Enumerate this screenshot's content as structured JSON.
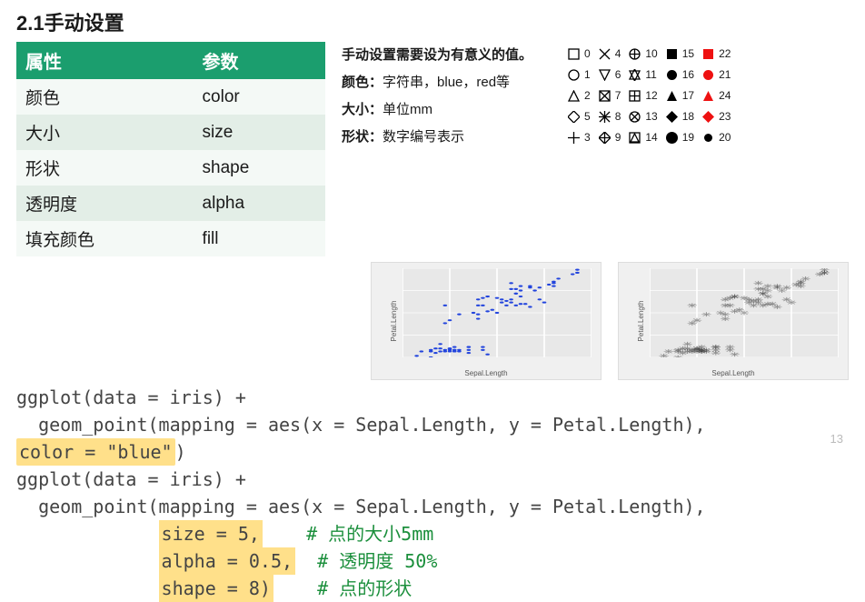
{
  "section_title": "2.1手动设置",
  "table": {
    "header_attr": "属性",
    "header_param": "参数",
    "rows": [
      {
        "attr": "颜色",
        "param": "color"
      },
      {
        "attr": "大小",
        "param": "size"
      },
      {
        "attr": "形状",
        "param": "shape"
      },
      {
        "attr": "透明度",
        "param": "alpha"
      },
      {
        "attr": "填充颜色",
        "param": "fill"
      }
    ]
  },
  "description": {
    "line1": "手动设置需要设为有意义的值。",
    "line2a": "颜色：",
    "line2b": "字符串，blue，red等",
    "line3a": "大小：",
    "line3b": "单位mm",
    "line4a": "形状：",
    "line4b": "数字编号表示"
  },
  "shape_legend": [
    {
      "n": 0,
      "sym": "square-open",
      "color": "#000"
    },
    {
      "n": 1,
      "sym": "circle-open",
      "color": "#000"
    },
    {
      "n": 2,
      "sym": "triangle-open",
      "color": "#000"
    },
    {
      "n": 5,
      "sym": "diamond-open",
      "color": "#000"
    },
    {
      "n": 3,
      "sym": "plus",
      "color": "#000"
    },
    {
      "n": 4,
      "sym": "cross",
      "color": "#000"
    },
    {
      "n": 6,
      "sym": "triangle-down-open",
      "color": "#000"
    },
    {
      "n": 7,
      "sym": "square-cross",
      "color": "#000"
    },
    {
      "n": 8,
      "sym": "asterisk",
      "color": "#000"
    },
    {
      "n": 9,
      "sym": "diamond-plus",
      "color": "#000"
    },
    {
      "n": 10,
      "sym": "circle-plus",
      "color": "#000"
    },
    {
      "n": 11,
      "sym": "star-david",
      "color": "#000"
    },
    {
      "n": 12,
      "sym": "square-plus",
      "color": "#000"
    },
    {
      "n": 13,
      "sym": "circle-cross",
      "color": "#000"
    },
    {
      "n": 14,
      "sym": "square-tri",
      "color": "#000"
    },
    {
      "n": 15,
      "sym": "square-solid",
      "color": "#000"
    },
    {
      "n": 16,
      "sym": "circle-solid",
      "color": "#000"
    },
    {
      "n": 17,
      "sym": "triangle-solid",
      "color": "#000"
    },
    {
      "n": 18,
      "sym": "diamond-solid",
      "color": "#000"
    },
    {
      "n": 19,
      "sym": "circle-solid-lg",
      "color": "#000"
    },
    {
      "n": 22,
      "sym": "square-solid",
      "color": "#e11"
    },
    {
      "n": 21,
      "sym": "circle-solid",
      "color": "#e11"
    },
    {
      "n": 24,
      "sym": "triangle-solid",
      "color": "#e11"
    },
    {
      "n": 23,
      "sym": "diamond-solid",
      "color": "#e11"
    },
    {
      "n": 20,
      "sym": "circle-solid-sm",
      "color": "#000"
    }
  ],
  "chart_data": [
    {
      "type": "scatter",
      "xlabel": "Sepal.Length",
      "ylabel": "Petal.Length",
      "marker": "dot-blue",
      "xlim": [
        4.0,
        8.0
      ],
      "ylim": [
        1,
        7
      ],
      "data": [
        [
          5.1,
          1.4
        ],
        [
          4.9,
          1.4
        ],
        [
          4.7,
          1.3
        ],
        [
          4.6,
          1.5
        ],
        [
          5.0,
          1.4
        ],
        [
          5.4,
          1.7
        ],
        [
          4.6,
          1.4
        ],
        [
          5.0,
          1.5
        ],
        [
          4.4,
          1.4
        ],
        [
          4.9,
          1.5
        ],
        [
          5.4,
          1.5
        ],
        [
          4.8,
          1.6
        ],
        [
          4.8,
          1.4
        ],
        [
          4.3,
          1.1
        ],
        [
          5.8,
          1.2
        ],
        [
          5.7,
          1.5
        ],
        [
          5.4,
          1.3
        ],
        [
          5.1,
          1.4
        ],
        [
          5.7,
          1.7
        ],
        [
          5.1,
          1.5
        ],
        [
          5.4,
          1.7
        ],
        [
          5.1,
          1.5
        ],
        [
          4.6,
          1.0
        ],
        [
          5.1,
          1.7
        ],
        [
          4.8,
          1.9
        ],
        [
          5.0,
          1.6
        ],
        [
          5.0,
          1.6
        ],
        [
          5.2,
          1.5
        ],
        [
          5.2,
          1.4
        ],
        [
          4.7,
          1.6
        ],
        [
          7.0,
          4.7
        ],
        [
          6.4,
          4.5
        ],
        [
          6.9,
          4.9
        ],
        [
          5.5,
          4.0
        ],
        [
          6.5,
          4.6
        ],
        [
          5.7,
          4.5
        ],
        [
          6.3,
          4.7
        ],
        [
          4.9,
          3.3
        ],
        [
          6.6,
          4.6
        ],
        [
          5.2,
          3.9
        ],
        [
          5.0,
          3.5
        ],
        [
          5.9,
          4.2
        ],
        [
          6.0,
          4.0
        ],
        [
          6.1,
          4.7
        ],
        [
          5.6,
          3.6
        ],
        [
          6.7,
          4.4
        ],
        [
          5.6,
          4.5
        ],
        [
          5.8,
          4.1
        ],
        [
          6.2,
          4.5
        ],
        [
          5.6,
          3.9
        ],
        [
          6.3,
          6.0
        ],
        [
          5.8,
          5.1
        ],
        [
          7.1,
          5.9
        ],
        [
          6.3,
          5.6
        ],
        [
          6.5,
          5.8
        ],
        [
          7.6,
          6.6
        ],
        [
          4.9,
          4.5
        ],
        [
          7.3,
          6.3
        ],
        [
          6.7,
          5.8
        ],
        [
          7.2,
          6.1
        ],
        [
          6.5,
          5.1
        ],
        [
          6.4,
          5.3
        ],
        [
          6.8,
          5.5
        ],
        [
          5.7,
          5.0
        ],
        [
          5.8,
          5.1
        ],
        [
          6.4,
          5.3
        ],
        [
          6.5,
          5.5
        ],
        [
          7.7,
          6.7
        ],
        [
          7.7,
          6.9
        ],
        [
          6.0,
          5.0
        ],
        [
          6.9,
          5.7
        ],
        [
          5.6,
          4.9
        ],
        [
          7.7,
          6.7
        ],
        [
          6.3,
          4.9
        ],
        [
          6.7,
          5.7
        ],
        [
          7.2,
          6.0
        ],
        [
          6.2,
          4.8
        ],
        [
          6.1,
          4.9
        ],
        [
          6.4,
          5.6
        ],
        [
          7.2,
          5.8
        ]
      ]
    },
    {
      "type": "scatter",
      "xlabel": "Sepal.Length",
      "ylabel": "Petal.Length",
      "marker": "asterisk-alpha",
      "xlim": [
        4.0,
        8.0
      ],
      "ylim": [
        1,
        7
      ],
      "size": 5,
      "alpha": 0.5,
      "shape": 8,
      "data": "same_as_0"
    }
  ],
  "code": {
    "l1": "ggplot(data = iris) +",
    "l2a": "  geom_point(mapping = aes(x = Sepal.Length, y = Petal.Length),",
    "l2hl": "color = \"blue\"",
    "l2paren": ")",
    "l3": "ggplot(data = iris) +",
    "l4": "  geom_point(mapping = aes(x = Sepal.Length, y = Petal.Length),",
    "l5_hl": "size = 5,",
    "l5_cm": "# 点的大小5mm",
    "l6_hl": "alpha = 0.5,",
    "l6_cm": "# 透明度 50%",
    "l7_hl": "shape = 8)",
    "l7_cm": "# 点的形状"
  },
  "page_number": "13"
}
